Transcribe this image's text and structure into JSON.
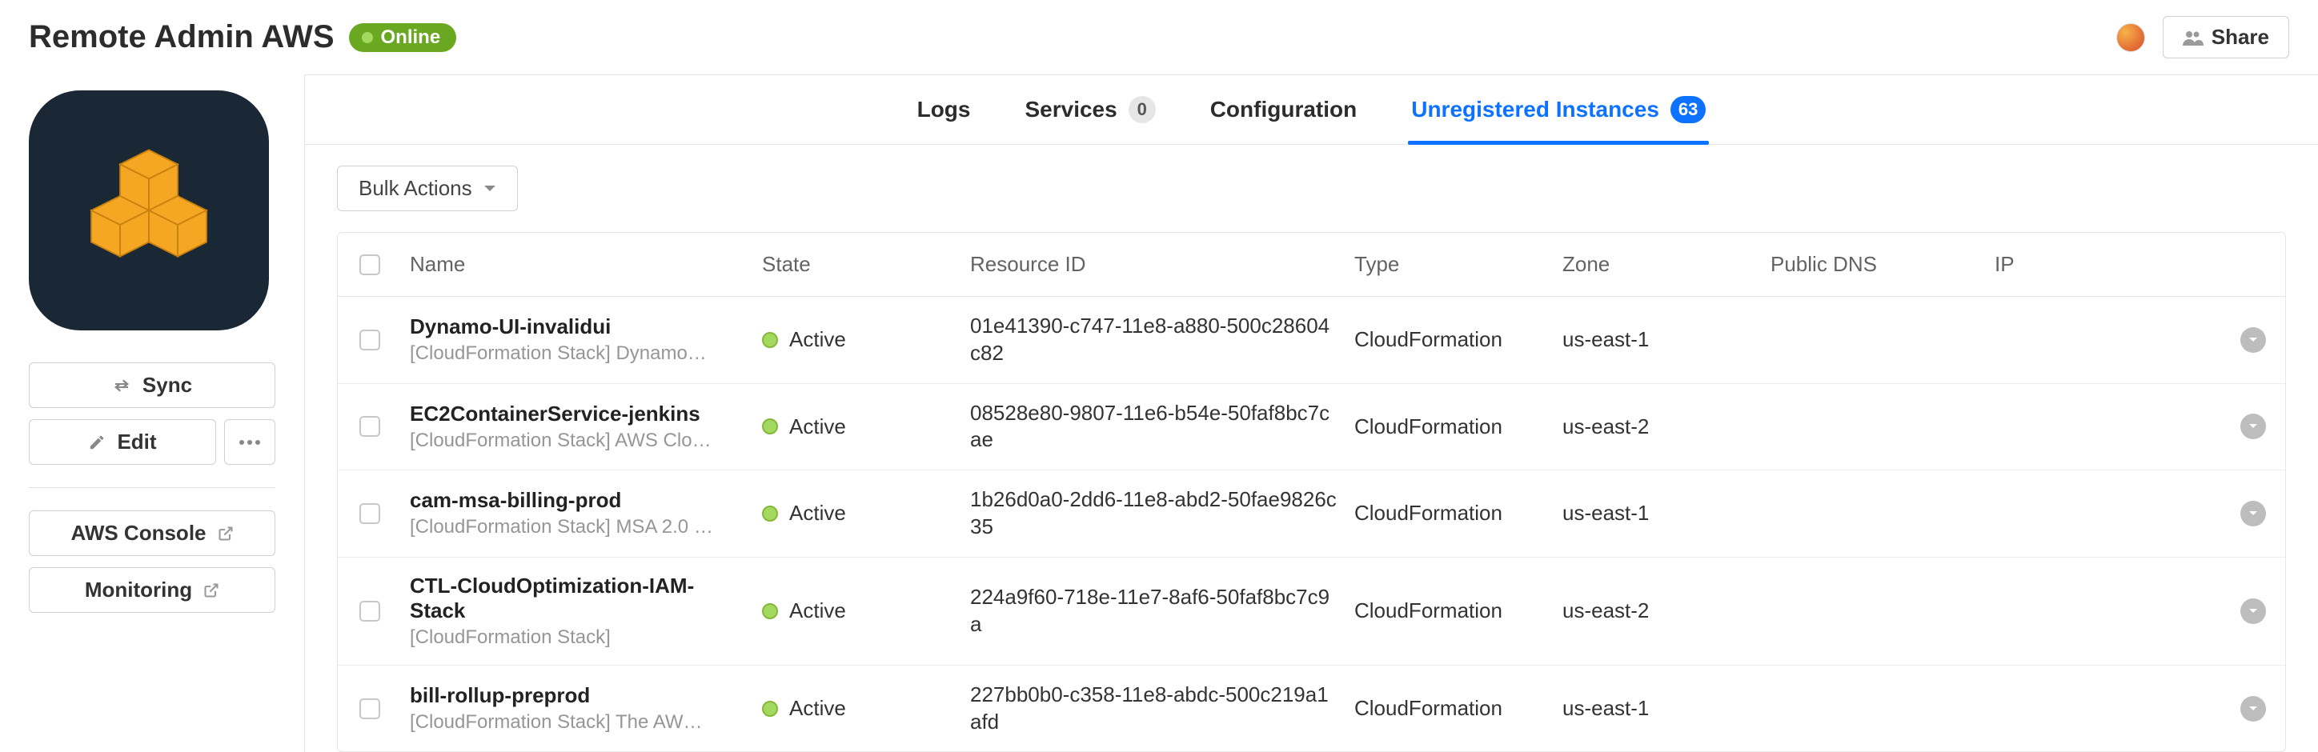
{
  "header": {
    "title": "Remote Admin AWS",
    "status": "Online",
    "share_label": "Share"
  },
  "sidebar": {
    "sync_label": "Sync",
    "edit_label": "Edit",
    "aws_console_label": "AWS Console",
    "monitoring_label": "Monitoring"
  },
  "tabs": {
    "logs": "Logs",
    "services": "Services",
    "services_count": "0",
    "configuration": "Configuration",
    "unreg": "Unregistered Instances",
    "unreg_count": "63"
  },
  "toolbar": {
    "bulk_label": "Bulk Actions"
  },
  "table": {
    "cols": {
      "name": "Name",
      "state": "State",
      "resource_id": "Resource ID",
      "type": "Type",
      "zone": "Zone",
      "public_dns": "Public DNS",
      "ip": "IP"
    },
    "state_active": "Active",
    "rows": [
      {
        "name": "Dynamo-UI-invalidui",
        "sub": "[CloudFormation Stack] Dynamo…",
        "resource_id": "01e41390-c747-11e8-a880-500c28604c82",
        "type": "CloudFormation",
        "zone": "us-east-1"
      },
      {
        "name": "EC2ContainerService-jenkins",
        "sub": "[CloudFormation Stack] AWS Clo…",
        "resource_id": "08528e80-9807-11e6-b54e-50faf8bc7cae",
        "type": "CloudFormation",
        "zone": "us-east-2"
      },
      {
        "name": "cam-msa-billing-prod",
        "sub": "[CloudFormation Stack] MSA 2.0 …",
        "resource_id": "1b26d0a0-2dd6-11e8-abd2-50fae9826c35",
        "type": "CloudFormation",
        "zone": "us-east-1"
      },
      {
        "name": "CTL-CloudOptimization-IAM-Stack",
        "sub": "[CloudFormation Stack]",
        "resource_id": "224a9f60-718e-11e7-8af6-50faf8bc7c9a",
        "type": "CloudFormation",
        "zone": "us-east-2"
      },
      {
        "name": "bill-rollup-preprod",
        "sub": "[CloudFormation Stack] The AW…",
        "resource_id": "227bb0b0-c358-11e8-abdc-500c219a1afd",
        "type": "CloudFormation",
        "zone": "us-east-1"
      }
    ]
  }
}
